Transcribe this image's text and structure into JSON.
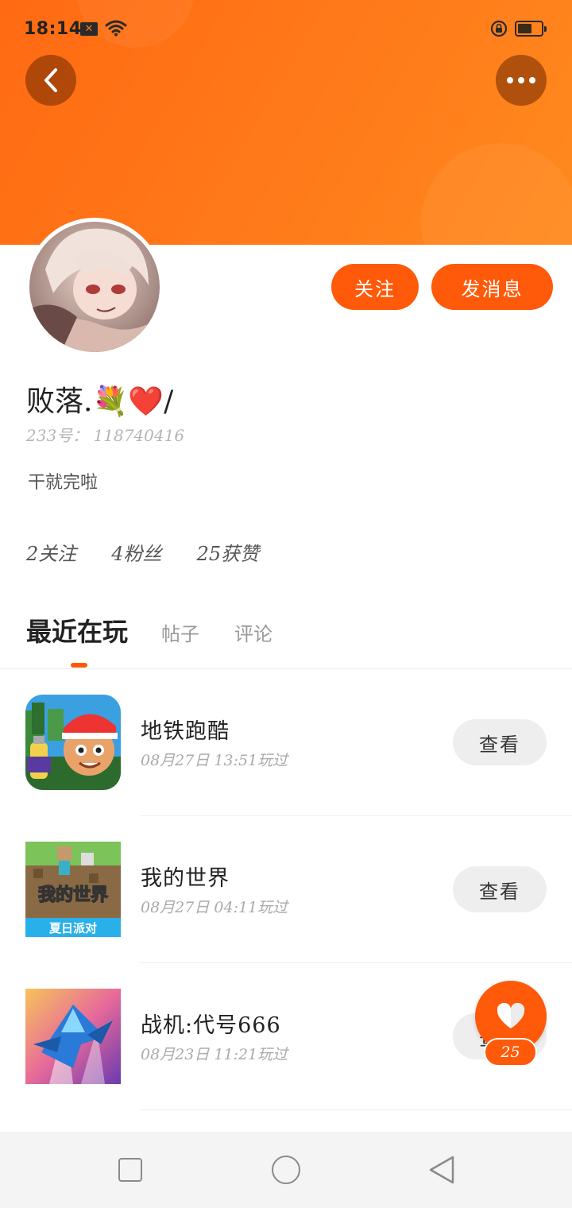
{
  "status_bar": {
    "time": "18:14",
    "notification_icon": "message-x-icon",
    "wifi_icon": "wifi-icon",
    "rotation_lock_icon": "rotation-lock-icon",
    "battery_icon": "battery-icon"
  },
  "header": {
    "back_icon": "chevron-left-icon",
    "more_icon": "more-horizontal-icon",
    "accent_color": "#fe5a0a"
  },
  "profile": {
    "avatar_icon": "user-avatar",
    "username": "败落.💐❤️/",
    "uid": "233号： 118740416",
    "bio": "干就完啦",
    "follow_label": "关注",
    "message_label": "发消息",
    "stats": {
      "following": "2关注",
      "followers": "4粉丝",
      "likes": "25获赞"
    }
  },
  "tabs": [
    {
      "label": "最近在玩"
    },
    {
      "label": "帖子"
    },
    {
      "label": "评论"
    }
  ],
  "games": [
    {
      "name": "地铁跑酷",
      "time": "08月27日 13:51玩过",
      "button": "查看"
    },
    {
      "name": "我的世界",
      "time": "08月27日 04:11玩过",
      "button": "查看",
      "icon_text": "我的世界",
      "icon_sub": "夏日派对"
    },
    {
      "name": "战机:代号666",
      "time": "08月23日 11:21玩过",
      "button": "查看"
    }
  ],
  "like_fab": {
    "icon": "heart-icon",
    "count": "25"
  },
  "nav_bar": {
    "recent_icon": "square-icon",
    "home_icon": "circle-icon",
    "back_icon": "triangle-back-icon"
  }
}
